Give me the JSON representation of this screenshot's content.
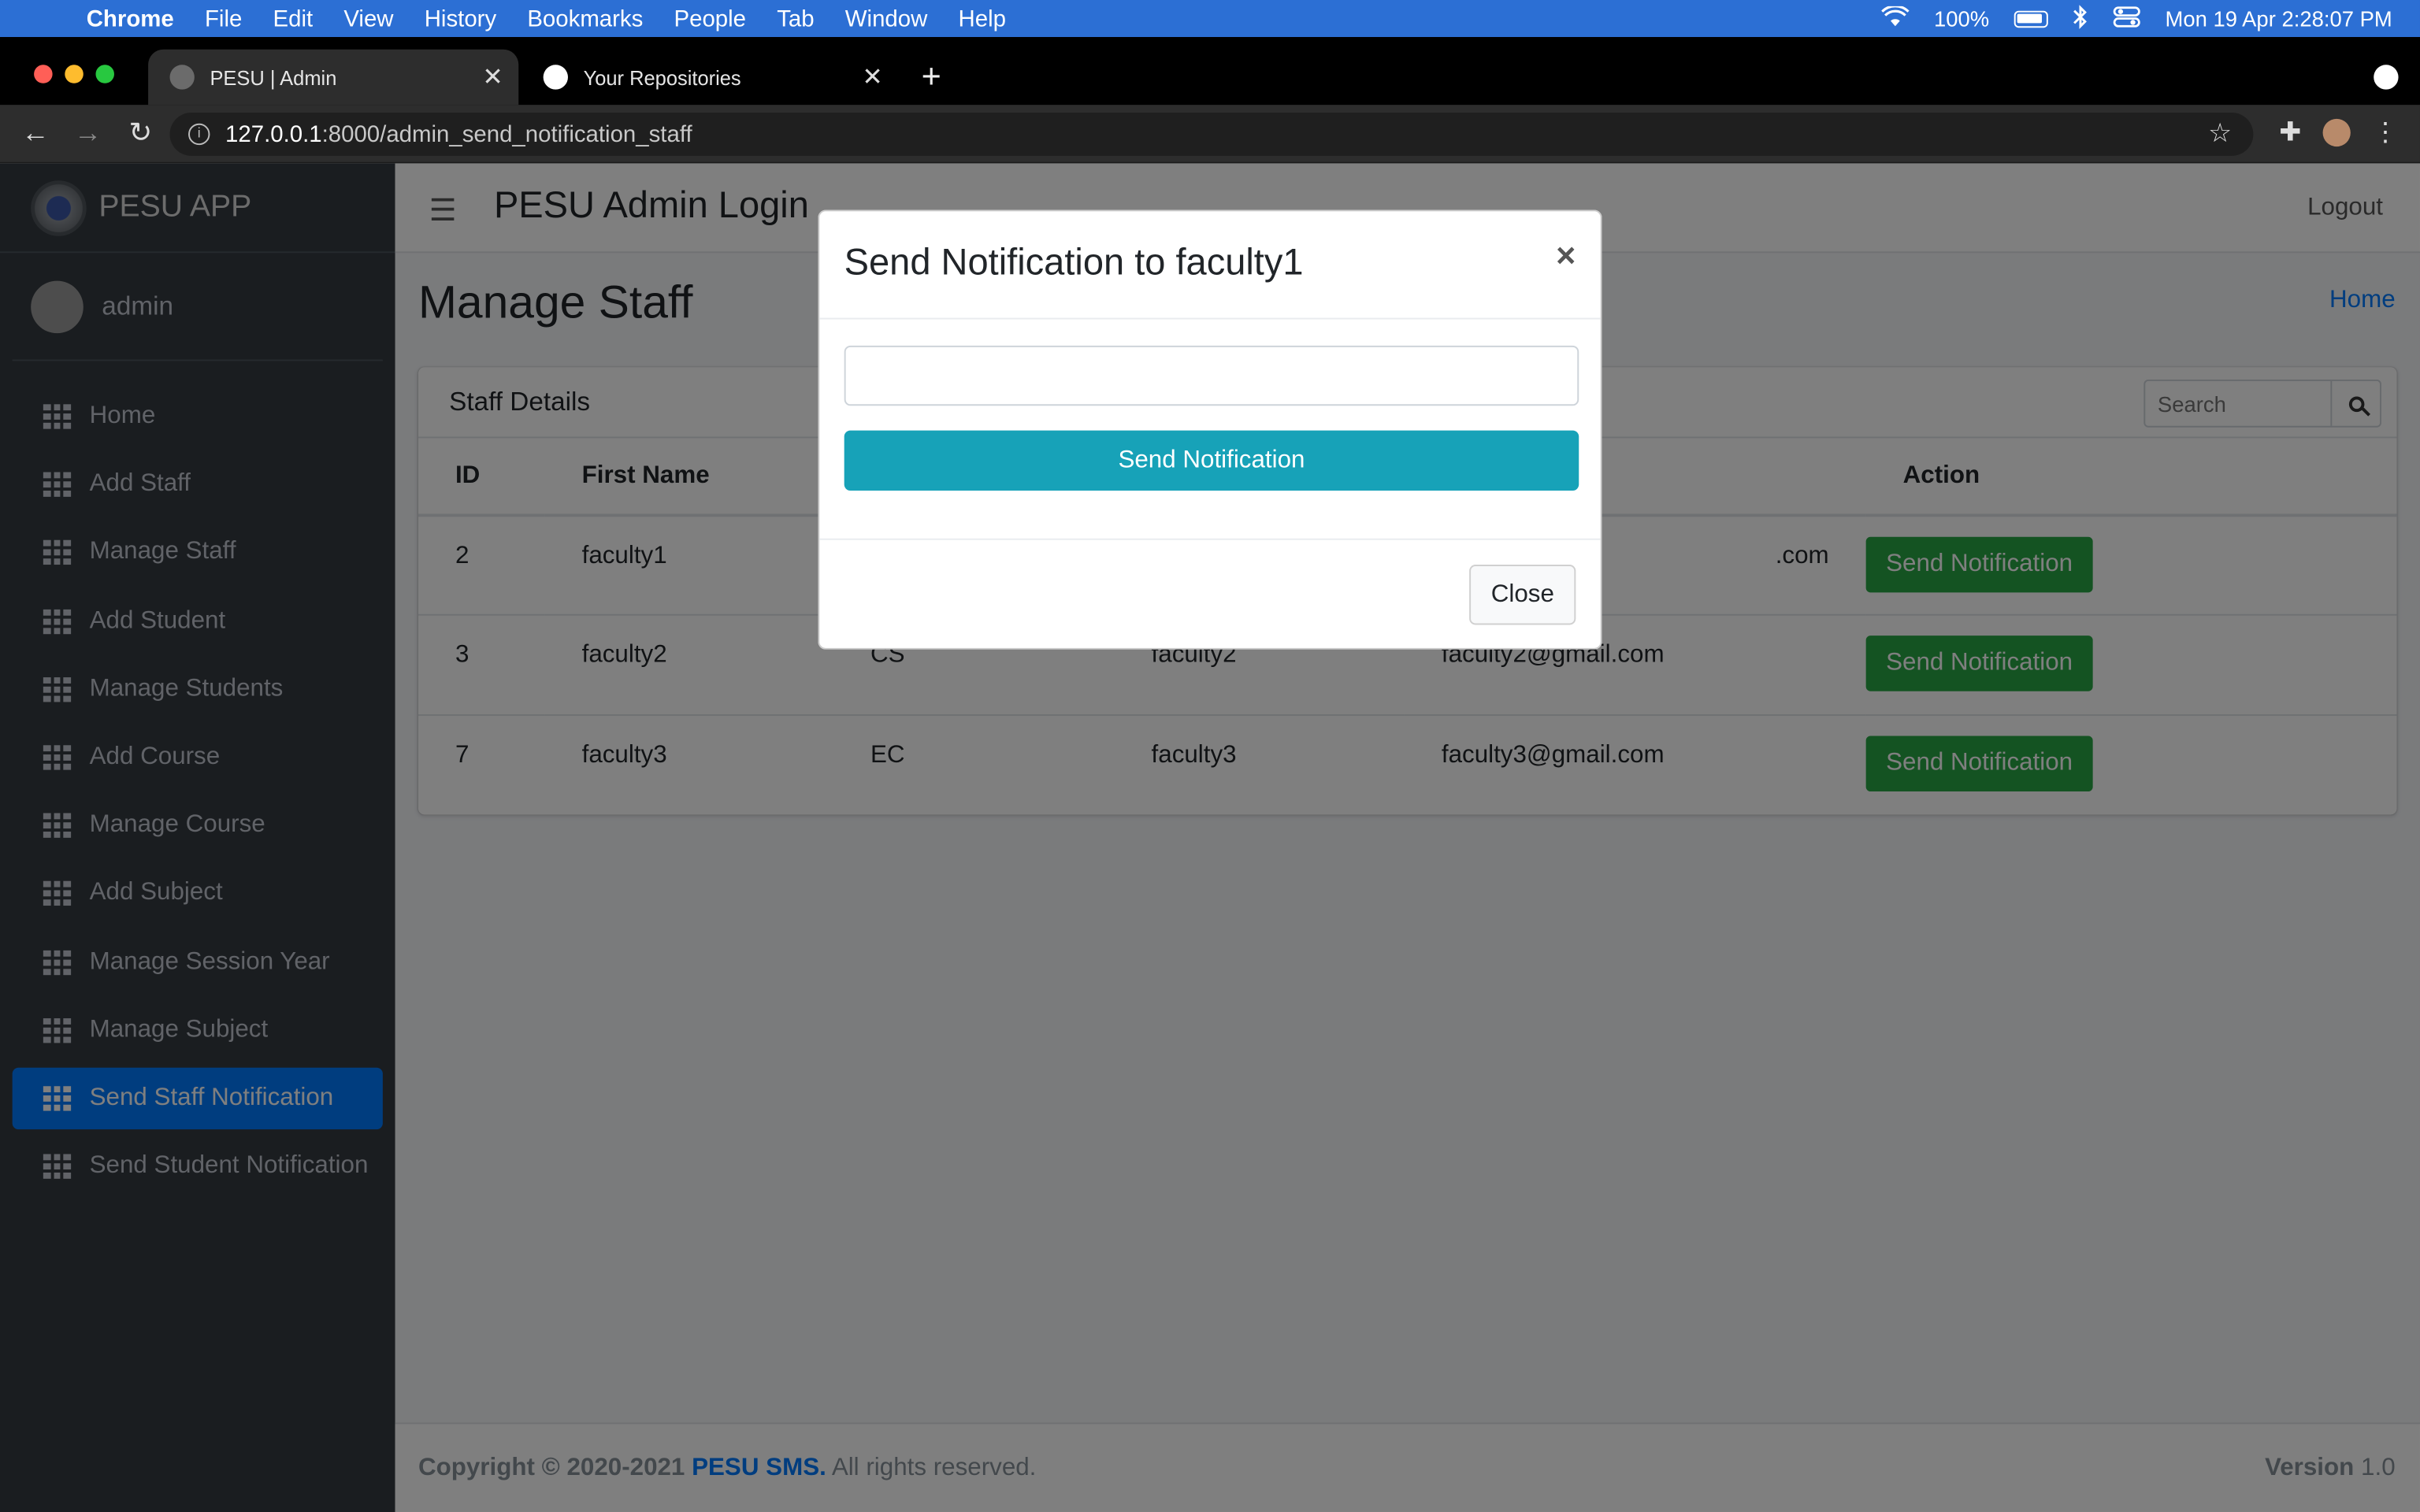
{
  "menubar": {
    "app": "Chrome",
    "items": [
      "File",
      "Edit",
      "View",
      "History",
      "Bookmarks",
      "People",
      "Tab",
      "Window",
      "Help"
    ],
    "battery": "100%",
    "datetime": "Mon 19 Apr  2:28:07 PM"
  },
  "browser": {
    "tabs": [
      {
        "title": "PESU | Admin"
      },
      {
        "title": "Your Repositories"
      }
    ],
    "url_host": "127.0.0.1",
    "url_rest": ":8000/admin_send_notification_staff"
  },
  "sidebar": {
    "brand": "PESU APP",
    "user": "admin",
    "items": [
      {
        "label": "Home"
      },
      {
        "label": "Add Staff"
      },
      {
        "label": "Manage Staff"
      },
      {
        "label": "Add Student"
      },
      {
        "label": "Manage Students"
      },
      {
        "label": "Add Course"
      },
      {
        "label": "Manage Course"
      },
      {
        "label": "Add Subject"
      },
      {
        "label": "Manage Session Year"
      },
      {
        "label": "Manage Subject"
      },
      {
        "label": "Send Staff Notification"
      },
      {
        "label": "Send Student Notification"
      }
    ]
  },
  "header": {
    "title": "PESU Admin Login",
    "logout": "Logout"
  },
  "page": {
    "title": "Manage Staff",
    "breadcrumb": "Home"
  },
  "card": {
    "title": "Staff Details",
    "search_placeholder": "Search",
    "columns": {
      "id": "ID",
      "first_name": "First Name",
      "action": "Action"
    },
    "rows": [
      {
        "id": "2",
        "first_name": "faculty1",
        "course": "",
        "username": "",
        "email": ".com",
        "action": "Send Notification"
      },
      {
        "id": "3",
        "first_name": "faculty2",
        "course": "CS",
        "username": "faculty2",
        "email": "faculty2@gmail.com",
        "action": "Send Notification"
      },
      {
        "id": "7",
        "first_name": "faculty3",
        "course": "EC",
        "username": "faculty3",
        "email": "faculty3@gmail.com",
        "action": "Send Notification"
      }
    ]
  },
  "footer": {
    "copyright": "Copyright © 2020-2021",
    "brand": "PESU SMS.",
    "rights": "All rights reserved.",
    "version_label": "Version",
    "version": "1.0"
  },
  "modal": {
    "title": "Send Notification to faculty1",
    "close_x": "×",
    "message_value": "",
    "send_label": "Send Notification",
    "close_label": "Close"
  },
  "colors": {
    "primary": "#007bff",
    "success": "#28a745",
    "info": "#17a2b8",
    "sidebar": "#343a40"
  }
}
